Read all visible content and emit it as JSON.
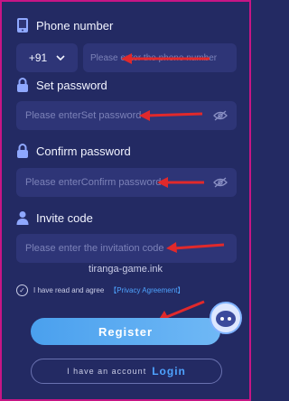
{
  "phone": {
    "label": "Phone number",
    "country_code": "+91",
    "placeholder": "Please enter the phone number"
  },
  "set_password": {
    "label": "Set password",
    "placeholder": "Please enterSet password"
  },
  "confirm_password": {
    "label": "Confirm password",
    "placeholder": "Please enterConfirm password"
  },
  "invite": {
    "label": "Invite code",
    "placeholder": "Please enter the invitation code"
  },
  "domain_text": "tiranga-game.ink",
  "agreement": {
    "text": "I have read and agree",
    "link": "【Privacy Agreement】"
  },
  "register_label": "Register",
  "login": {
    "prefix": "I have an account",
    "link": "Login"
  },
  "colors": {
    "background": "#232A63",
    "field": "#2E3577",
    "accent": "#4EA3FF",
    "annotation_arrow": "#E0292B",
    "frame": "#C71585"
  }
}
